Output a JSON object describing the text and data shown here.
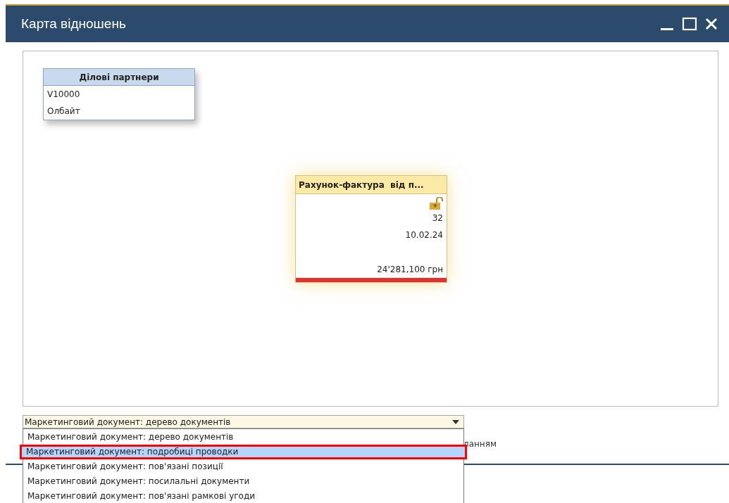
{
  "window": {
    "title": "Карта відношень",
    "controls": [
      {
        "kind": "minimize"
      },
      {
        "kind": "maximize"
      },
      {
        "kind": "close"
      }
    ]
  },
  "nodes": [
    {
      "kind": "partners",
      "title": "Ділові партнери",
      "lines": [
        "V10000",
        "Олбайт"
      ]
    },
    {
      "kind": "document",
      "title": "Рахунок-фактура  від п...",
      "locked": false,
      "number": "32",
      "date": "10.02.24",
      "amount": "24'281,100 грн",
      "color": "#e53030"
    }
  ],
  "view_dropdown": {
    "value": "Маркетинговий документ: дерево документів",
    "expanded": true,
    "options": [
      {
        "label": "Маркетинговий документ: дерево документів",
        "highlighted": false,
        "outlined": false
      },
      {
        "label": "Маркетинговий документ: подробиці проводки",
        "highlighted": true,
        "outlined": true
      },
      {
        "label": "Маркетинговий документ: пов'язані позиції",
        "highlighted": false,
        "outlined": false
      },
      {
        "label": "Маркетинговий документ: посилальні документи",
        "highlighted": false,
        "outlined": false
      },
      {
        "label": "Маркетинговий документ: пов'язані рамкові угоди",
        "highlighted": false,
        "outlined": false
      }
    ]
  },
  "partial_label": "ланням"
}
